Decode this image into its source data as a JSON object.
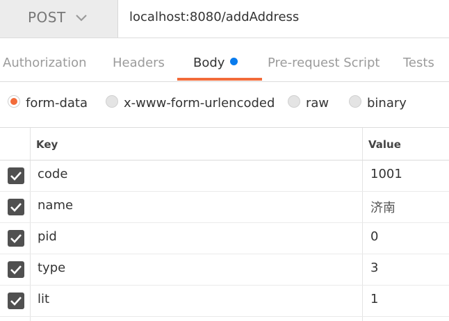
{
  "request": {
    "method": "POST",
    "url": "localhost:8080/addAddress"
  },
  "tabs": [
    {
      "label": "Authorization"
    },
    {
      "label": "Headers"
    },
    {
      "label": "Body",
      "active": true,
      "indicator_color": "#097bed"
    },
    {
      "label": "Pre-request Script"
    },
    {
      "label": "Tests"
    }
  ],
  "body_types": [
    {
      "label": "form-data",
      "selected": true
    },
    {
      "label": "x-www-form-urlencoded",
      "selected": false
    },
    {
      "label": "raw",
      "selected": false
    },
    {
      "label": "binary",
      "selected": false
    }
  ],
  "table": {
    "headers": {
      "key": "Key",
      "value": "Value"
    },
    "rows": [
      {
        "checked": true,
        "key": "code",
        "value": "1001"
      },
      {
        "checked": true,
        "key": "name",
        "value": "济南"
      },
      {
        "checked": true,
        "key": "pid",
        "value": "0"
      },
      {
        "checked": true,
        "key": "type",
        "value": "3"
      },
      {
        "checked": true,
        "key": "lit",
        "value": "1"
      }
    ]
  },
  "colors": {
    "accent": "#f26b3a",
    "body_dot": "#097bed",
    "checkbox": "#505050"
  },
  "icons": {
    "method_dropdown": "chevron-down-icon",
    "checkbox": "checkmark-icon"
  }
}
